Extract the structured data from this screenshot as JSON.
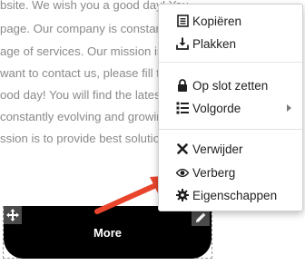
{
  "page": {
    "lines": [
      "bsite. We wish you a good day! You",
      "page. Our company is constantly",
      "age of services. Our mission is to p",
      "want to contact us, please fill the",
      "ood day! You will find the latest in",
      "constantly evolving and growing. Y",
      "ssion is to provide best solution th"
    ]
  },
  "widget": {
    "button_label": "More"
  },
  "context_menu": {
    "items": [
      {
        "label": "Kopiëren",
        "icon": "copy-icon"
      },
      {
        "label": "Plakken",
        "icon": "paste-icon"
      },
      {
        "label": "Op slot zetten",
        "icon": "lock-icon"
      },
      {
        "label": "Volgorde",
        "icon": "layers-icon",
        "has_submenu": true
      },
      {
        "label": "Verwijder",
        "icon": "close-icon"
      },
      {
        "label": "Verberg",
        "icon": "eye-icon"
      },
      {
        "label": "Eigenschappen",
        "icon": "gear-icon"
      }
    ]
  },
  "colors": {
    "accent_arrow": "#e8452c",
    "button_bg": "#000000",
    "button_text": "#ffffff"
  }
}
